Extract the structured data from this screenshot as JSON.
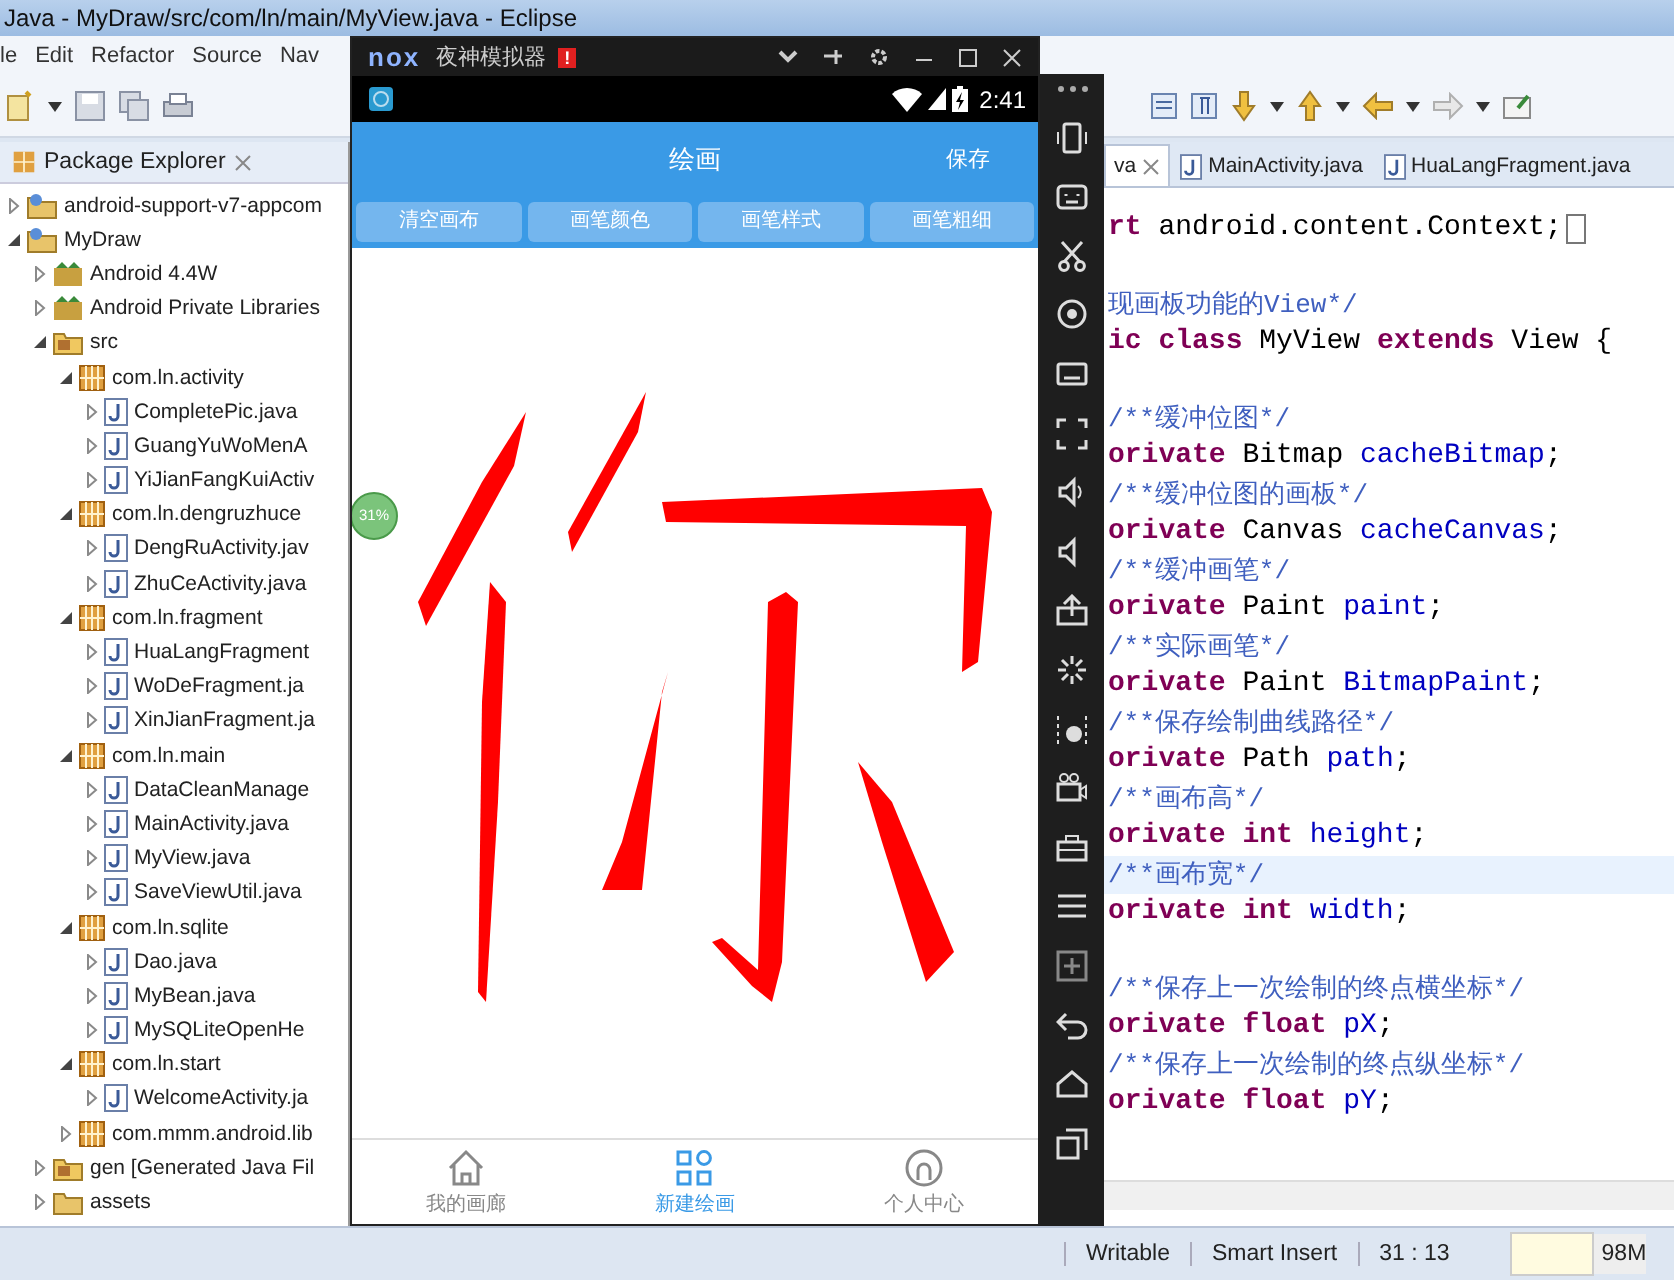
{
  "window": {
    "title": "Java - MyDraw/src/com/ln/main/MyView.java - Eclipse"
  },
  "menu": [
    "le",
    "Edit",
    "Refactor",
    "Source",
    "Nav"
  ],
  "package_explorer": {
    "title": "Package Explorer",
    "tree": [
      {
        "label": "android-support-v7-appcom",
        "kind": "project",
        "expanded": false
      },
      {
        "label": "MyDraw",
        "kind": "project",
        "expanded": true,
        "children": [
          {
            "label": "Android 4.4W",
            "kind": "library",
            "expanded": false
          },
          {
            "label": "Android Private Libraries",
            "kind": "library",
            "expanded": false
          },
          {
            "label": "src",
            "kind": "srcfolder",
            "expanded": true,
            "children": [
              {
                "label": "com.ln.activity",
                "kind": "package",
                "expanded": true,
                "children": [
                  {
                    "label": "CompletePic.java",
                    "kind": "java",
                    "expanded": false
                  },
                  {
                    "label": "GuangYuWoMenA",
                    "kind": "java",
                    "expanded": false
                  },
                  {
                    "label": "YiJianFangKuiActiv",
                    "kind": "java",
                    "expanded": false
                  }
                ]
              },
              {
                "label": "com.ln.dengruzhuce",
                "kind": "package",
                "expanded": true,
                "children": [
                  {
                    "label": "DengRuActivity.jav",
                    "kind": "java",
                    "expanded": false
                  },
                  {
                    "label": "ZhuCeActivity.java",
                    "kind": "java",
                    "expanded": false
                  }
                ]
              },
              {
                "label": "com.ln.fragment",
                "kind": "package",
                "expanded": true,
                "children": [
                  {
                    "label": "HuaLangFragment",
                    "kind": "java",
                    "expanded": false
                  },
                  {
                    "label": "WoDeFragment.ja",
                    "kind": "java",
                    "expanded": false
                  },
                  {
                    "label": "XinJianFragment.ja",
                    "kind": "java",
                    "expanded": false
                  }
                ]
              },
              {
                "label": "com.ln.main",
                "kind": "package",
                "expanded": true,
                "children": [
                  {
                    "label": "DataCleanManage",
                    "kind": "java",
                    "expanded": false
                  },
                  {
                    "label": "MainActivity.java",
                    "kind": "java",
                    "expanded": false
                  },
                  {
                    "label": "MyView.java",
                    "kind": "java",
                    "expanded": false
                  },
                  {
                    "label": "SaveViewUtil.java",
                    "kind": "java",
                    "expanded": false
                  }
                ]
              },
              {
                "label": "com.ln.sqlite",
                "kind": "package",
                "expanded": true,
                "children": [
                  {
                    "label": "Dao.java",
                    "kind": "java",
                    "expanded": false
                  },
                  {
                    "label": "MyBean.java",
                    "kind": "java",
                    "expanded": false
                  },
                  {
                    "label": "MySQLiteOpenHe",
                    "kind": "java",
                    "expanded": false
                  }
                ]
              },
              {
                "label": "com.ln.start",
                "kind": "package",
                "expanded": true,
                "children": [
                  {
                    "label": "WelcomeActivity.ja",
                    "kind": "java",
                    "expanded": false
                  }
                ]
              },
              {
                "label": "com.mmm.android.lib",
                "kind": "package",
                "expanded": false
              }
            ]
          },
          {
            "label": "gen [Generated Java Fil",
            "kind": "genfolder",
            "expanded": false
          },
          {
            "label": "assets",
            "kind": "folder",
            "expanded": false
          }
        ]
      }
    ]
  },
  "editor": {
    "tabs": [
      {
        "label": "va",
        "selected": true,
        "closable": true
      },
      {
        "label": "MainActivity.java",
        "selected": false,
        "closable": false
      },
      {
        "label": "HuaLangFragment.java",
        "selected": false,
        "closable": false
      }
    ],
    "lines": [
      {
        "current": false,
        "tokens": [
          {
            "text": "rt",
            "kind": "keyword"
          },
          {
            "text": " android.content.Context;",
            "kind": "plain"
          }
        ]
      },
      {
        "current": false
      },
      {
        "current": false,
        "tokens": [
          {
            "text": "现画板功能的View*/",
            "kind": "comment"
          }
        ]
      },
      {
        "current": false,
        "tokens": [
          {
            "text": "ic",
            "kind": "keyword"
          },
          {
            "text": " class",
            "kind": "keyword"
          },
          {
            "text": " MyView ",
            "kind": "plain"
          },
          {
            "text": "extends",
            "kind": "keyword"
          },
          {
            "text": " View {",
            "kind": "plain"
          }
        ]
      },
      {
        "current": false
      },
      {
        "current": false,
        "tokens": [
          {
            "text": "/**缓冲位图*/",
            "kind": "comment"
          }
        ]
      },
      {
        "current": false,
        "tokens": [
          {
            "text": "orivate",
            "kind": "keyword"
          },
          {
            "text": " Bitmap ",
            "kind": "plain"
          },
          {
            "text": "cacheBitmap",
            "kind": "field"
          },
          {
            "text": ";",
            "kind": "plain"
          }
        ]
      },
      {
        "current": false,
        "tokens": [
          {
            "text": "/**缓冲位图的画板*/",
            "kind": "comment"
          }
        ]
      },
      {
        "current": false,
        "tokens": [
          {
            "text": "orivate",
            "kind": "keyword"
          },
          {
            "text": " Canvas ",
            "kind": "plain"
          },
          {
            "text": "cacheCanvas",
            "kind": "field"
          },
          {
            "text": ";",
            "kind": "plain"
          }
        ]
      },
      {
        "current": false,
        "tokens": [
          {
            "text": "/**缓冲画笔*/",
            "kind": "comment"
          }
        ]
      },
      {
        "current": false,
        "tokens": [
          {
            "text": "orivate",
            "kind": "keyword"
          },
          {
            "text": " Paint ",
            "kind": "plain"
          },
          {
            "text": "paint",
            "kind": "field"
          },
          {
            "text": ";",
            "kind": "plain"
          }
        ]
      },
      {
        "current": false,
        "tokens": [
          {
            "text": "/**实际画笔*/",
            "kind": "comment"
          }
        ]
      },
      {
        "current": false,
        "tokens": [
          {
            "text": "orivate",
            "kind": "keyword"
          },
          {
            "text": " Paint ",
            "kind": "plain"
          },
          {
            "text": "BitmapPaint",
            "kind": "field"
          },
          {
            "text": ";",
            "kind": "plain"
          }
        ]
      },
      {
        "current": false,
        "tokens": [
          {
            "text": "/**保存绘制曲线路径*/",
            "kind": "comment"
          }
        ]
      },
      {
        "current": false,
        "tokens": [
          {
            "text": "orivate",
            "kind": "keyword"
          },
          {
            "text": " Path ",
            "kind": "plain"
          },
          {
            "text": "path",
            "kind": "field"
          },
          {
            "text": ";",
            "kind": "plain"
          }
        ]
      },
      {
        "current": false,
        "tokens": [
          {
            "text": "/**画布高*/",
            "kind": "comment"
          }
        ]
      },
      {
        "current": false,
        "tokens": [
          {
            "text": "orivate",
            "kind": "keyword"
          },
          {
            "text": " int",
            "kind": "keyword"
          },
          {
            "text": " height",
            "kind": "field"
          },
          {
            "text": ";",
            "kind": "plain"
          }
        ]
      },
      {
        "current": true,
        "tokens": [
          {
            "text": "/**画布宽*/",
            "kind": "comment"
          }
        ]
      },
      {
        "current": false,
        "tokens": [
          {
            "text": "orivate",
            "kind": "keyword"
          },
          {
            "text": " int",
            "kind": "keyword"
          },
          {
            "text": " width",
            "kind": "field"
          },
          {
            "text": ";",
            "kind": "plain"
          }
        ]
      },
      {
        "current": false
      },
      {
        "current": false,
        "tokens": [
          {
            "text": "/**保存上一次绘制的终点横坐标*/",
            "kind": "comment"
          }
        ]
      },
      {
        "current": false,
        "tokens": [
          {
            "text": "orivate",
            "kind": "keyword"
          },
          {
            "text": " float",
            "kind": "keyword"
          },
          {
            "text": " pX",
            "kind": "field"
          },
          {
            "text": ";",
            "kind": "plain"
          }
        ]
      },
      {
        "current": false,
        "tokens": [
          {
            "text": "/**保存上一次绘制的终点纵坐标*/",
            "kind": "comment"
          }
        ]
      },
      {
        "current": false,
        "tokens": [
          {
            "text": "orivate",
            "kind": "keyword"
          },
          {
            "text": " float",
            "kind": "keyword"
          },
          {
            "text": " pY",
            "kind": "field"
          },
          {
            "text": ";",
            "kind": "plain"
          }
        ]
      }
    ]
  },
  "status_bar": {
    "mode": "Writable",
    "insert": "Smart Insert",
    "position": "31 : 13",
    "heap": "98M"
  },
  "emulator": {
    "logo": "nox",
    "title": "夜神模拟器",
    "alert": "!",
    "clock": "2:41",
    "app": {
      "title": "绘画",
      "save": "保存",
      "buttons": [
        "清空画布",
        "画笔颜色",
        "画笔样式",
        "画笔粗细"
      ],
      "progress_badge": "31%",
      "nav": [
        {
          "label": "我的画廊",
          "kind": "home",
          "selected": false
        },
        {
          "label": "新建绘画",
          "kind": "grid",
          "selected": true
        },
        {
          "label": "个人中心",
          "kind": "person",
          "selected": false
        }
      ]
    }
  }
}
